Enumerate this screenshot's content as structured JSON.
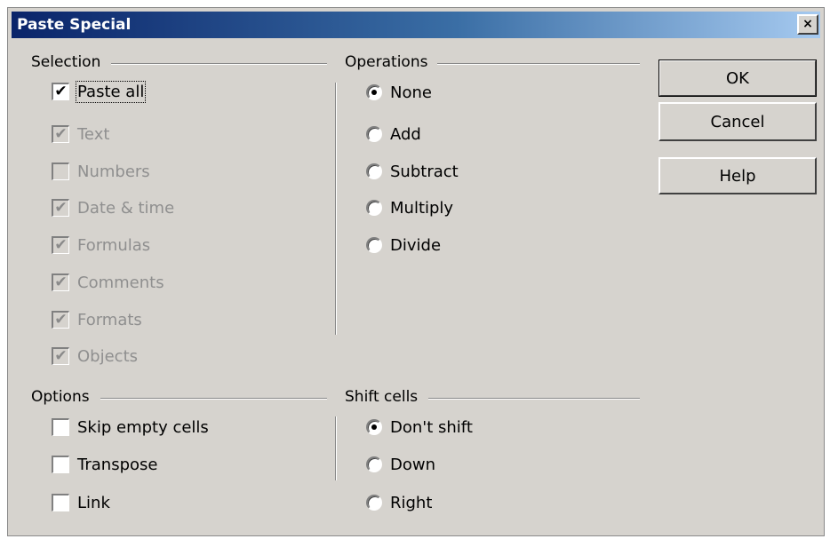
{
  "window": {
    "title": "Paste Special",
    "close_label": "×"
  },
  "selection": {
    "title": "Selection",
    "items": [
      {
        "label": "Paste all",
        "checked": true,
        "enabled": true
      },
      {
        "label": "Text",
        "checked": true,
        "enabled": false
      },
      {
        "label": "Numbers",
        "checked": false,
        "enabled": false
      },
      {
        "label": "Date & time",
        "checked": true,
        "enabled": false
      },
      {
        "label": "Formulas",
        "checked": true,
        "enabled": false
      },
      {
        "label": "Comments",
        "checked": true,
        "enabled": false
      },
      {
        "label": "Formats",
        "checked": true,
        "enabled": false
      },
      {
        "label": "Objects",
        "checked": true,
        "enabled": false
      }
    ]
  },
  "operations": {
    "title": "Operations",
    "items": [
      {
        "label": "None",
        "selected": true
      },
      {
        "label": "Add",
        "selected": false
      },
      {
        "label": "Subtract",
        "selected": false
      },
      {
        "label": "Multiply",
        "selected": false
      },
      {
        "label": "Divide",
        "selected": false
      }
    ]
  },
  "options": {
    "title": "Options",
    "items": [
      {
        "label": "Skip empty cells",
        "checked": false
      },
      {
        "label": "Transpose",
        "checked": false
      },
      {
        "label": "Link",
        "checked": false
      }
    ]
  },
  "shift_cells": {
    "title": "Shift cells",
    "items": [
      {
        "label": "Don't shift",
        "selected": true
      },
      {
        "label": "Down",
        "selected": false
      },
      {
        "label": "Right",
        "selected": false
      }
    ]
  },
  "buttons": {
    "ok": "OK",
    "cancel": "Cancel",
    "help": "Help"
  },
  "check_glyph": "✔"
}
